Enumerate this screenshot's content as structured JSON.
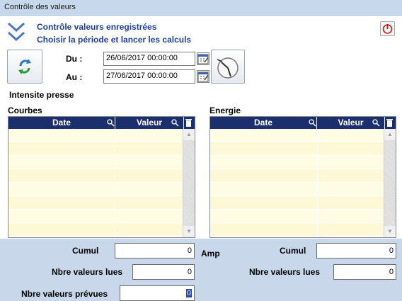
{
  "window": {
    "title": "Contrôle des valeurs"
  },
  "header": {
    "line1": "Contrôle valeurs enregistrées",
    "line2": "Choisir la période et lancer les calculs",
    "icon": "double-chevron-down-icon",
    "close_icon": "power-icon"
  },
  "period": {
    "from_label": "Du :",
    "from_value": "26/06/2017 00:00:00",
    "to_label": "Au :",
    "to_value": "27/06/2017 00:00:00"
  },
  "section_title": "Intensite presse",
  "left": {
    "title": "Courbes",
    "columns": [
      "Date",
      "Valeur"
    ],
    "cumul_label": "Cumul",
    "cumul_value": "0",
    "lues_label": "Nbre valeurs lues",
    "lues_value": "0",
    "prevues_label": "Nbre valeurs prévues",
    "prevues_value": "0"
  },
  "right": {
    "title": "Energie",
    "columns": [
      "Date",
      "Valeur"
    ],
    "cumul_label": "Cumul",
    "cumul_value": "0",
    "lues_label": "Nbre valeurs lues",
    "lues_value": "0"
  },
  "unit_label": "Amp",
  "colors": {
    "header_blue": "#1f3fa0",
    "grid_header": "#1b2f6f",
    "row_fill": "#fffce4",
    "band": "#c9d7ea",
    "close_red": "#d01818"
  }
}
